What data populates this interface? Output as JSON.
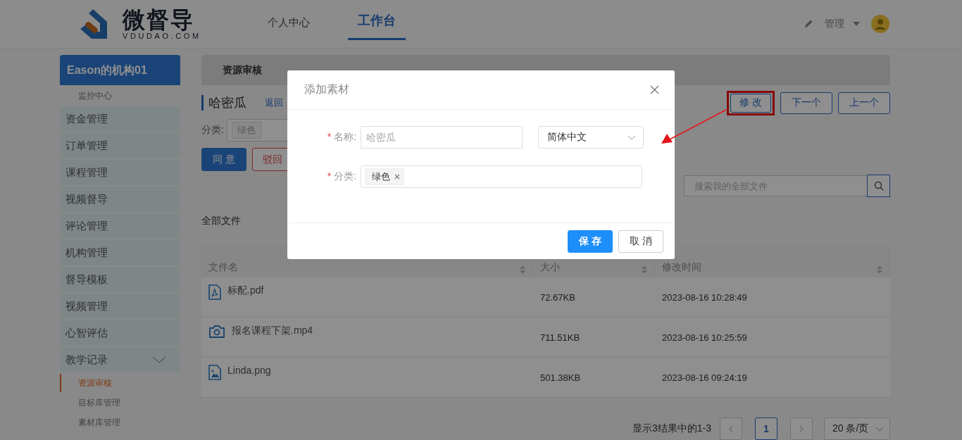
{
  "header": {
    "logo_text": "微督导",
    "logo_subtext": "VDUDAO.COM",
    "nav": [
      {
        "label": "个人中心",
        "selected": false
      },
      {
        "label": "工作台",
        "selected": true
      }
    ],
    "user_menu": "管理"
  },
  "sidebar": {
    "org": "Eason的机构01",
    "items": [
      {
        "label": "监控中心",
        "kind": "link",
        "selected": false
      },
      {
        "label": "资金管理",
        "kind": "section"
      },
      {
        "label": "订单管理",
        "kind": "section"
      },
      {
        "label": "课程管理",
        "kind": "section"
      },
      {
        "label": "视频督导",
        "kind": "section"
      },
      {
        "label": "评论管理",
        "kind": "section"
      },
      {
        "label": "机构管理",
        "kind": "section"
      },
      {
        "label": "督导模板",
        "kind": "section"
      },
      {
        "label": "视频管理",
        "kind": "section"
      },
      {
        "label": "心智评估",
        "kind": "section"
      },
      {
        "label": "教学记录",
        "kind": "group",
        "expanded": true,
        "children": [
          {
            "label": "资源审核",
            "selected": true
          },
          {
            "label": "目标库管理",
            "selected": false
          },
          {
            "label": "素材库管理",
            "selected": false
          }
        ]
      }
    ]
  },
  "main": {
    "tab": "资源审核",
    "title": "哈密瓜",
    "back_link": "返回",
    "category_label": "分类:",
    "category_tag": "绿色",
    "actions": [
      {
        "label": "同 意",
        "kind": "primary"
      },
      {
        "label": "驳回",
        "kind": "danger"
      }
    ],
    "nav_buttons": [
      {
        "label": "修 改",
        "highlighted": true
      },
      {
        "label": "下一个",
        "highlighted": false
      },
      {
        "label": "上一个",
        "highlighted": false
      }
    ],
    "search": {
      "placeholder": "搜索我的全部文件"
    },
    "section_title": "全部文件",
    "table": {
      "columns": [
        "文件名",
        "大小",
        "修改时间"
      ],
      "rows": [
        {
          "kind": "pdf",
          "name": "标配.pdf",
          "size": "72.67KB",
          "modified": "2023-08-16 10:28:49"
        },
        {
          "kind": "video",
          "name": "报名课程下架.mp4",
          "size": "711.51KB",
          "modified": "2023-08-16 10:25:59"
        },
        {
          "kind": "image",
          "name": "Linda.png",
          "size": "501.38KB",
          "modified": "2023-08-16 09:24:19"
        }
      ]
    },
    "pagination": {
      "summary": "显示3结果中的1-3",
      "pages": [
        {
          "label": "1",
          "selected": true
        }
      ],
      "page_size": "20 条/页"
    }
  },
  "modal": {
    "title": "添加素材",
    "name_required_mark": "*",
    "name_label": "名称:",
    "category_required_mark": "*",
    "name_placeholder": "哈密瓜",
    "language": "简体中文",
    "category_label": "分类:",
    "tags": [
      "绿色"
    ],
    "buttons": [
      {
        "label": "保 存",
        "kind": "primary"
      },
      {
        "label": "取 消",
        "kind": "default"
      }
    ]
  }
}
